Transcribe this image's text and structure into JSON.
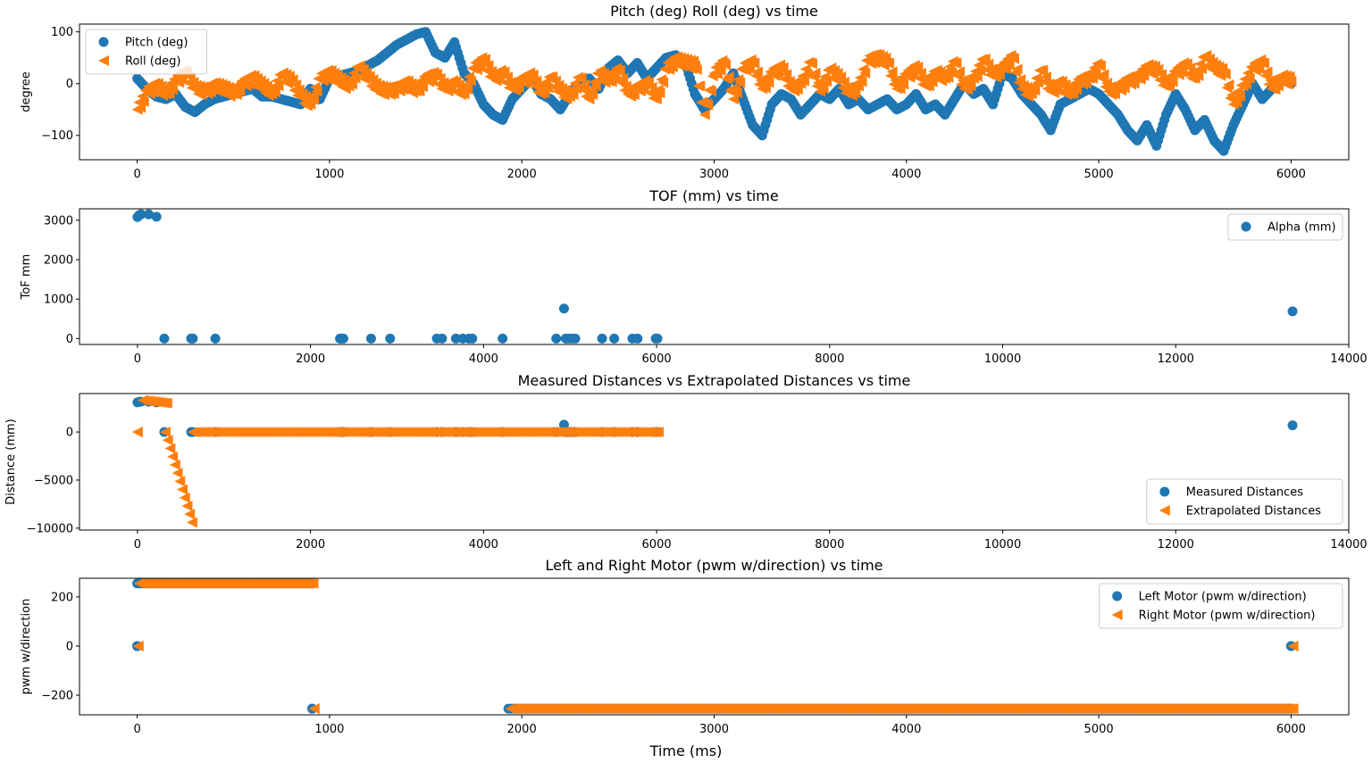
{
  "figure": {
    "shared_xlabel": "Time (ms)",
    "colors": {
      "blue": "#1f77b4",
      "orange": "#ff7f0e"
    }
  },
  "chart_data": [
    {
      "id": "pitch-roll",
      "type": "scatter",
      "title": "Pitch (deg) Roll (deg) vs time",
      "xlabel": "",
      "ylabel": "degree",
      "xlim": [
        -300,
        6300
      ],
      "ylim": [
        -147,
        115
      ],
      "xticks": [
        0,
        1000,
        2000,
        3000,
        4000,
        5000,
        6000
      ],
      "yticks": [
        -100,
        0,
        100
      ],
      "grid": false,
      "legend": "top-left",
      "series": [
        {
          "name": "Pitch (deg)",
          "marker": "circle",
          "color": "#1f77b4",
          "x": [
            0,
            50,
            100,
            150,
            200,
            250,
            300,
            350,
            400,
            450,
            500,
            550,
            600,
            650,
            700,
            750,
            800,
            850,
            900,
            950,
            1000,
            1050,
            1100,
            1150,
            1200,
            1250,
            1300,
            1350,
            1400,
            1450,
            1500,
            1550,
            1600,
            1650,
            1700,
            1750,
            1800,
            1850,
            1900,
            1950,
            2000,
            2050,
            2100,
            2150,
            2200,
            2250,
            2300,
            2350,
            2400,
            2450,
            2500,
            2550,
            2600,
            2650,
            2700,
            2750,
            2800,
            2850,
            2900,
            2950,
            3000,
            3050,
            3100,
            3150,
            3200,
            3250,
            3300,
            3350,
            3400,
            3450,
            3500,
            3550,
            3600,
            3650,
            3700,
            3750,
            3800,
            3850,
            3900,
            3950,
            4000,
            4050,
            4100,
            4150,
            4200,
            4250,
            4300,
            4350,
            4400,
            4450,
            4500,
            4550,
            4600,
            4650,
            4700,
            4750,
            4800,
            4850,
            4900,
            4950,
            5000,
            5050,
            5100,
            5150,
            5200,
            5250,
            5300,
            5350,
            5400,
            5450,
            5500,
            5550,
            5600,
            5650,
            5700,
            5750,
            5800,
            5850,
            5900,
            5950,
            6000
          ],
          "y": [
            10,
            -10,
            -25,
            -30,
            -20,
            -45,
            -55,
            -40,
            -30,
            -25,
            -20,
            -15,
            -10,
            -25,
            -25,
            -30,
            -35,
            -40,
            -10,
            -30,
            10,
            15,
            20,
            25,
            35,
            45,
            60,
            75,
            85,
            95,
            100,
            60,
            50,
            80,
            20,
            0,
            -40,
            -60,
            -70,
            -30,
            -10,
            10,
            -20,
            -30,
            -50,
            -20,
            0,
            10,
            -10,
            30,
            45,
            20,
            40,
            10,
            30,
            50,
            55,
            40,
            -20,
            -50,
            -30,
            -10,
            20,
            -30,
            -80,
            -100,
            -40,
            -20,
            -30,
            -60,
            -40,
            -20,
            -30,
            -10,
            -40,
            -30,
            -50,
            -40,
            -30,
            -50,
            -40,
            -20,
            -50,
            -40,
            -60,
            -30,
            0,
            -20,
            -10,
            -40,
            20,
            10,
            -20,
            -40,
            -60,
            -90,
            -40,
            -30,
            -20,
            -10,
            -20,
            -40,
            -60,
            -90,
            -110,
            -80,
            -120,
            -60,
            -20,
            -50,
            -90,
            -70,
            -110,
            -130,
            -80,
            -40,
            0,
            -30,
            -10,
            10,
            0
          ]
        },
        {
          "name": "Roll (deg)",
          "marker": "triangle-left",
          "color": "#ff7f0e",
          "x": [
            0,
            50,
            100,
            150,
            200,
            250,
            300,
            350,
            400,
            450,
            500,
            550,
            600,
            650,
            700,
            750,
            800,
            850,
            900,
            950,
            1000,
            1050,
            1100,
            1150,
            1200,
            1250,
            1300,
            1350,
            1400,
            1450,
            1500,
            1550,
            1600,
            1650,
            1700,
            1750,
            1800,
            1850,
            1900,
            1950,
            2000,
            2050,
            2100,
            2150,
            2200,
            2250,
            2300,
            2350,
            2400,
            2450,
            2500,
            2550,
            2600,
            2650,
            2700,
            2750,
            2800,
            2850,
            2900,
            2950,
            3000,
            3050,
            3100,
            3150,
            3200,
            3250,
            3300,
            3350,
            3400,
            3450,
            3500,
            3550,
            3600,
            3650,
            3700,
            3750,
            3800,
            3850,
            3900,
            3950,
            4000,
            4050,
            4100,
            4150,
            4200,
            4250,
            4300,
            4350,
            4400,
            4450,
            4500,
            4550,
            4600,
            4650,
            4700,
            4750,
            4800,
            4850,
            4900,
            4950,
            5000,
            5050,
            5100,
            5150,
            5200,
            5250,
            5300,
            5350,
            5400,
            5450,
            5500,
            5550,
            5600,
            5650,
            5700,
            5750,
            5800,
            5850,
            5900,
            5950,
            6000
          ],
          "y": [
            -50,
            -15,
            -5,
            -20,
            5,
            20,
            -10,
            -15,
            -5,
            -10,
            -20,
            0,
            10,
            -5,
            -20,
            15,
            5,
            -25,
            -40,
            10,
            20,
            5,
            -5,
            30,
            10,
            -10,
            -15,
            -10,
            0,
            -15,
            10,
            15,
            -10,
            0,
            -20,
            30,
            45,
            10,
            20,
            -10,
            5,
            15,
            -20,
            10,
            -15,
            -25,
            10,
            -30,
            20,
            5,
            25,
            -20,
            -10,
            0,
            -30,
            30,
            45,
            40,
            35,
            -60,
            20,
            40,
            -30,
            30,
            40,
            -10,
            20,
            30,
            -10,
            0,
            40,
            -15,
            25,
            10,
            -20,
            -5,
            45,
            50,
            40,
            -10,
            15,
            30,
            -5,
            20,
            10,
            40,
            -10,
            10,
            45,
            15,
            30,
            50,
            -10,
            -20,
            25,
            -15,
            0,
            -20,
            5,
            10,
            35,
            -15,
            -10,
            5,
            10,
            30,
            25,
            -5,
            20,
            35,
            10,
            50,
            30,
            20,
            -40,
            -5,
            30,
            40,
            -10,
            10,
            5
          ]
        }
      ]
    },
    {
      "id": "tof",
      "type": "scatter",
      "title": "TOF (mm) vs time",
      "xlabel": "",
      "ylabel": "ToF mm",
      "xlim": [
        -670,
        14000
      ],
      "ylim": [
        -150,
        3290
      ],
      "xticks": [
        0,
        2000,
        4000,
        6000,
        8000,
        10000,
        12000,
        14000
      ],
      "yticks": [
        0,
        1000,
        2000,
        3000
      ],
      "grid": false,
      "legend": "top-right",
      "series": [
        {
          "name": "Alpha (mm)",
          "marker": "circle",
          "color": "#1f77b4",
          "x": [
            0,
            20,
            40,
            130,
            220,
            310,
            620,
            640,
            900,
            2340,
            2360,
            2380,
            2700,
            2920,
            3460,
            3520,
            3680,
            3760,
            3830,
            3870,
            4220,
            4840,
            4930,
            4950,
            4970,
            5000,
            5030,
            5060,
            5370,
            5510,
            5720,
            5780,
            5990,
            6010,
            13350
          ],
          "y": [
            3080,
            3130,
            3150,
            3150,
            3090,
            0,
            0,
            0,
            0,
            0,
            0,
            0,
            0,
            0,
            0,
            0,
            0,
            0,
            0,
            0,
            0,
            0,
            760,
            0,
            0,
            0,
            0,
            0,
            0,
            0,
            0,
            0,
            0,
            0,
            690
          ]
        }
      ]
    },
    {
      "id": "distances",
      "type": "scatter",
      "title": "Measured Distances vs Extrapolated Distances vs time",
      "xlabel": "",
      "ylabel": "Distance (mm)",
      "xlim": [
        -670,
        14000
      ],
      "ylim": [
        -10200,
        4000
      ],
      "xticks": [
        0,
        2000,
        4000,
        6000,
        8000,
        10000,
        12000,
        14000
      ],
      "yticks": [
        -10000,
        -5000,
        0
      ],
      "grid": false,
      "legend": "bottom-right",
      "series": [
        {
          "name": "Measured Distances",
          "marker": "circle",
          "color": "#1f77b4",
          "x": [
            0,
            20,
            40,
            130,
            220,
            310,
            620,
            640,
            900,
            2340,
            2360,
            2380,
            2700,
            2920,
            3460,
            3520,
            3680,
            3760,
            3830,
            3870,
            4220,
            4840,
            4930,
            4950,
            4970,
            5000,
            5030,
            5060,
            5370,
            5510,
            5720,
            5780,
            5990,
            6010,
            13350
          ],
          "y": [
            3080,
            3130,
            3150,
            3150,
            3090,
            0,
            0,
            0,
            0,
            0,
            0,
            0,
            0,
            0,
            0,
            0,
            0,
            0,
            0,
            0,
            0,
            0,
            760,
            0,
            0,
            0,
            0,
            0,
            0,
            0,
            0,
            0,
            0,
            0,
            690
          ]
        },
        {
          "name": "Extrapolated Distances",
          "marker": "triangle-left",
          "color": "#ff7f0e",
          "segments": [
            {
              "x_start": 0,
              "x_end": 0,
              "y_start": 0,
              "y_end": 0
            },
            {
              "x_start": 60,
              "x_end": 340,
              "y_start": 3300,
              "y_end": 3000
            },
            {
              "x_start": 320,
              "x_end": 630,
              "y_start": 0,
              "y_end": -9400
            },
            {
              "x_start": 640,
              "x_end": 6020,
              "y_start": 0,
              "y_end": 0
            }
          ]
        }
      ]
    },
    {
      "id": "motors",
      "type": "scatter",
      "title": "Left and Right Motor (pwm w/direction) vs time",
      "xlabel": "Time (ms)",
      "ylabel": "pwm w/direction",
      "xlim": [
        -300,
        6300
      ],
      "ylim": [
        -280,
        276
      ],
      "xticks": [
        0,
        1000,
        2000,
        3000,
        4000,
        5000,
        6000
      ],
      "yticks": [
        -200,
        0,
        200
      ],
      "grid": false,
      "legend": "top-right",
      "series": [
        {
          "name": "Left Motor (pwm w/direction)",
          "marker": "circle",
          "color": "#1f77b4",
          "segments": [
            {
              "x_start": 0,
              "x_end": 0,
              "y": 0
            },
            {
              "x_start": 0,
              "x_end": 910,
              "y": 255
            },
            {
              "x_start": 910,
              "x_end": 910,
              "y": -255
            },
            {
              "x_start": 1930,
              "x_end": 6000,
              "y": -255
            },
            {
              "x_start": 6000,
              "x_end": 6000,
              "y": 0
            }
          ]
        },
        {
          "name": "Right Motor (pwm w/direction)",
          "marker": "triangle-left",
          "color": "#ff7f0e",
          "segments": [
            {
              "x_start": 5,
              "x_end": 5,
              "y": 0
            },
            {
              "x_start": 10,
              "x_end": 915,
              "y": 255
            },
            {
              "x_start": 920,
              "x_end": 920,
              "y": -255
            },
            {
              "x_start": 1940,
              "x_end": 6010,
              "y": -255
            },
            {
              "x_start": 6010,
              "x_end": 6010,
              "y": 0
            }
          ]
        }
      ]
    }
  ]
}
